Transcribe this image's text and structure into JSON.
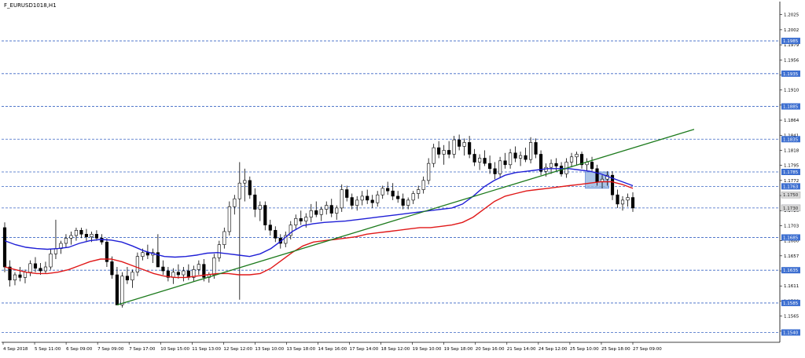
{
  "window": {
    "title": "F_EURUSD1018,H1"
  },
  "colors": {
    "background": "#ffffff",
    "bull_body": "#ffffff",
    "bear_body": "#000000",
    "candle_outline": "#000000",
    "ma_fast": "#1f1fd6",
    "ma_slow": "#e01818",
    "trendline": "#1c7a1c",
    "level_line": "#3a66c4",
    "level_tag": "#3d6fd0",
    "zone_fill": "#8fb0dd",
    "axis": "#000000",
    "grid": "#6b8fd4"
  },
  "chart_data": {
    "type": "candlestick",
    "title": "F_EURUSD1018,H1",
    "ylim": [
      1.1525,
      1.2045
    ],
    "grid": "horizontal dashed price levels",
    "y_ticks": [
      "1.2025",
      "1.2002",
      "1.1979",
      "1.1956",
      "1.1933",
      "1.1910",
      "1.1887",
      "1.1864",
      "1.1841",
      "1.1818",
      "1.1795",
      "1.1772",
      "1.1749",
      "1.1726",
      "1.1703",
      "1.1680",
      "1.1657",
      "1.1634",
      "1.1611",
      "1.1588",
      "1.1565",
      "1.1542"
    ],
    "level_lines": [
      "1.1985",
      "1.1935",
      "1.1885",
      "1.1835",
      "1.1785",
      "1.1763",
      "1.1730",
      "1.1685",
      "1.1635",
      "1.1585",
      "1.1540"
    ],
    "x_labels": [
      "4 Sep 2018",
      "5 Sep 11:00",
      "6 Sep 09:00",
      "7 Sep 09:00",
      "7 Sep 17:00",
      "10 Sep 15:00",
      "11 Sep 13:00",
      "12 Sep 12:00",
      "13 Sep 10:00",
      "13 Sep 18:00",
      "14 Sep 16:00",
      "17 Sep 14:00",
      "18 Sep 12:00",
      "19 Sep 10:00",
      "19 Sep 18:00",
      "20 Sep 16:00",
      "21 Sep 14:00",
      "24 Sep 12:00",
      "25 Sep 10:00",
      "25 Sep 18:00",
      "27 Sep 09:00"
    ],
    "candles": [
      [
        1.17,
        1.1708,
        1.1632,
        1.164
      ],
      [
        1.164,
        1.165,
        1.161,
        1.162
      ],
      [
        1.162,
        1.1632,
        1.1612,
        1.1628
      ],
      [
        1.1628,
        1.164,
        1.1618,
        1.1624
      ],
      [
        1.1624,
        1.1636,
        1.1615,
        1.1632
      ],
      [
        1.1632,
        1.165,
        1.1626,
        1.1645
      ],
      [
        1.1645,
        1.1655,
        1.1632,
        1.1638
      ],
      [
        1.1638,
        1.1646,
        1.1628,
        1.1634
      ],
      [
        1.1634,
        1.1648,
        1.163,
        1.164
      ],
      [
        1.164,
        1.1668,
        1.1636,
        1.166
      ],
      [
        1.166,
        1.1712,
        1.1652,
        1.1668
      ],
      [
        1.1668,
        1.168,
        1.166,
        1.1676
      ],
      [
        1.1676,
        1.169,
        1.167,
        1.1684
      ],
      [
        1.1684,
        1.1694,
        1.1674,
        1.1688
      ],
      [
        1.1688,
        1.17,
        1.168,
        1.1696
      ],
      [
        1.1696,
        1.17,
        1.1684,
        1.169
      ],
      [
        1.169,
        1.1698,
        1.1678,
        1.1686
      ],
      [
        1.1686,
        1.1694,
        1.1678,
        1.169
      ],
      [
        1.169,
        1.1696,
        1.168,
        1.1684
      ],
      [
        1.1684,
        1.169,
        1.1674,
        1.1678
      ],
      [
        1.1678,
        1.1684,
        1.164,
        1.1648
      ],
      [
        1.1648,
        1.1656,
        1.1622,
        1.1628
      ],
      [
        1.1628,
        1.164,
        1.1592,
        1.1582
      ],
      [
        1.1582,
        1.1632,
        1.1578,
        1.1626
      ],
      [
        1.1626,
        1.164,
        1.1614,
        1.162
      ],
      [
        1.162,
        1.1636,
        1.1608,
        1.1632
      ],
      [
        1.1632,
        1.1662,
        1.1626,
        1.1656
      ],
      [
        1.1656,
        1.1668,
        1.165,
        1.1662
      ],
      [
        1.1662,
        1.1674,
        1.1652,
        1.1658
      ],
      [
        1.1658,
        1.1668,
        1.1646,
        1.1662
      ],
      [
        1.1662,
        1.169,
        1.1656,
        1.164
      ],
      [
        1.164,
        1.165,
        1.1628,
        1.1634
      ],
      [
        1.1634,
        1.164,
        1.1618,
        1.1624
      ],
      [
        1.1624,
        1.1638,
        1.1614,
        1.1632
      ],
      [
        1.1632,
        1.1644,
        1.1622,
        1.1628
      ],
      [
        1.1628,
        1.164,
        1.1618,
        1.1634
      ],
      [
        1.1634,
        1.1644,
        1.162,
        1.1624
      ],
      [
        1.1624,
        1.1642,
        1.1618,
        1.1636
      ],
      [
        1.1636,
        1.165,
        1.1628,
        1.1644
      ],
      [
        1.1644,
        1.1652,
        1.1618,
        1.1624
      ],
      [
        1.1624,
        1.1632,
        1.1616,
        1.1628
      ],
      [
        1.1628,
        1.166,
        1.1622,
        1.1654
      ],
      [
        1.1654,
        1.168,
        1.1648,
        1.1674
      ],
      [
        1.1674,
        1.17,
        1.1668,
        1.1694
      ],
      [
        1.1694,
        1.174,
        1.1688,
        1.1732
      ],
      [
        1.1732,
        1.175,
        1.172,
        1.1744
      ],
      [
        1.1744,
        1.18,
        1.159,
        1.1768
      ],
      [
        1.1768,
        1.179,
        1.174,
        1.1772
      ],
      [
        1.1772,
        1.1778,
        1.1744,
        1.175
      ],
      [
        1.175,
        1.176,
        1.1716,
        1.1728
      ],
      [
        1.1728,
        1.174,
        1.171,
        1.1734
      ],
      [
        1.1734,
        1.174,
        1.1696,
        1.1704
      ],
      [
        1.1704,
        1.1712,
        1.1688,
        1.1696
      ],
      [
        1.1696,
        1.1702,
        1.1678,
        1.1684
      ],
      [
        1.1684,
        1.169,
        1.1668,
        1.1676
      ],
      [
        1.1676,
        1.1694,
        1.167,
        1.1688
      ],
      [
        1.1688,
        1.171,
        1.1682,
        1.1704
      ],
      [
        1.1704,
        1.172,
        1.1698,
        1.1714
      ],
      [
        1.1714,
        1.1726,
        1.1704,
        1.171
      ],
      [
        1.171,
        1.1722,
        1.17,
        1.1716
      ],
      [
        1.1716,
        1.1736,
        1.1708,
        1.1726
      ],
      [
        1.1726,
        1.174,
        1.1716,
        1.172
      ],
      [
        1.172,
        1.1732,
        1.171,
        1.1728
      ],
      [
        1.1728,
        1.174,
        1.172,
        1.1734
      ],
      [
        1.1734,
        1.1744,
        1.1716,
        1.1722
      ],
      [
        1.1722,
        1.1734,
        1.1712,
        1.173
      ],
      [
        1.173,
        1.1766,
        1.1724,
        1.1758
      ],
      [
        1.1758,
        1.1764,
        1.174,
        1.1746
      ],
      [
        1.1746,
        1.1752,
        1.1728,
        1.1734
      ],
      [
        1.1734,
        1.1748,
        1.1726,
        1.1742
      ],
      [
        1.1742,
        1.1756,
        1.1734,
        1.1748
      ],
      [
        1.1748,
        1.1758,
        1.1736,
        1.1742
      ],
      [
        1.1742,
        1.175,
        1.173,
        1.1738
      ],
      [
        1.1738,
        1.1756,
        1.1732,
        1.175
      ],
      [
        1.175,
        1.1764,
        1.1744,
        1.176
      ],
      [
        1.176,
        1.177,
        1.175,
        1.1756
      ],
      [
        1.1756,
        1.1768,
        1.1742,
        1.1748
      ],
      [
        1.1748,
        1.1756,
        1.1738,
        1.1744
      ],
      [
        1.1744,
        1.1752,
        1.1728,
        1.1734
      ],
      [
        1.1734,
        1.1746,
        1.1728,
        1.1742
      ],
      [
        1.1742,
        1.1756,
        1.1736,
        1.1752
      ],
      [
        1.1752,
        1.1764,
        1.1744,
        1.1758
      ],
      [
        1.1758,
        1.1778,
        1.1752,
        1.1772
      ],
      [
        1.1772,
        1.1806,
        1.1766,
        1.1798
      ],
      [
        1.1798,
        1.1828,
        1.1792,
        1.1822
      ],
      [
        1.1822,
        1.1832,
        1.1806,
        1.1812
      ],
      [
        1.1812,
        1.1826,
        1.1796,
        1.1818
      ],
      [
        1.1818,
        1.1832,
        1.1806,
        1.1812
      ],
      [
        1.1812,
        1.184,
        1.1806,
        1.1834
      ],
      [
        1.1834,
        1.1842,
        1.1818,
        1.1824
      ],
      [
        1.1824,
        1.1836,
        1.181,
        1.183
      ],
      [
        1.183,
        1.184,
        1.1806,
        1.1812
      ],
      [
        1.1812,
        1.182,
        1.1794,
        1.18
      ],
      [
        1.18,
        1.1812,
        1.1788,
        1.1806
      ],
      [
        1.1806,
        1.1818,
        1.1794,
        1.1798
      ],
      [
        1.1798,
        1.181,
        1.1782,
        1.179
      ],
      [
        1.179,
        1.18,
        1.1774,
        1.1782
      ],
      [
        1.1782,
        1.1808,
        1.1776,
        1.1802
      ],
      [
        1.1802,
        1.1814,
        1.179,
        1.1796
      ],
      [
        1.1796,
        1.182,
        1.179,
        1.1814
      ],
      [
        1.1814,
        1.1824,
        1.18,
        1.1806
      ],
      [
        1.1806,
        1.1816,
        1.1794,
        1.181
      ],
      [
        1.181,
        1.1822,
        1.18,
        1.1804
      ],
      [
        1.1804,
        1.1838,
        1.1798,
        1.183
      ],
      [
        1.183,
        1.1836,
        1.1806,
        1.1812
      ],
      [
        1.1812,
        1.1818,
        1.178,
        1.1786
      ],
      [
        1.1786,
        1.1798,
        1.1778,
        1.1792
      ],
      [
        1.1792,
        1.1804,
        1.1782,
        1.1798
      ],
      [
        1.1798,
        1.1806,
        1.1786,
        1.1794
      ],
      [
        1.1794,
        1.18,
        1.1778,
        1.1782
      ],
      [
        1.1782,
        1.1806,
        1.1776,
        1.18
      ],
      [
        1.18,
        1.1814,
        1.1792,
        1.1808
      ],
      [
        1.1808,
        1.1816,
        1.1796,
        1.1812
      ],
      [
        1.1812,
        1.1816,
        1.179,
        1.1796
      ],
      [
        1.1796,
        1.1806,
        1.1786,
        1.18
      ],
      [
        1.18,
        1.1808,
        1.1786,
        1.179
      ],
      [
        1.179,
        1.1796,
        1.1764,
        1.177
      ],
      [
        1.177,
        1.178,
        1.176,
        1.1774
      ],
      [
        1.1774,
        1.1786,
        1.1764,
        1.178
      ],
      [
        1.178,
        1.1786,
        1.1742,
        1.175
      ],
      [
        1.175,
        1.1758,
        1.173,
        1.1736
      ],
      [
        1.1736,
        1.1748,
        1.1726,
        1.1742
      ],
      [
        1.1742,
        1.1752,
        1.1732,
        1.1746
      ],
      [
        1.1746,
        1.1754,
        1.1724,
        1.173
      ]
    ],
    "ma_fast": [
      1.168,
      1.1674,
      1.167,
      1.1668,
      1.1667,
      1.1668,
      1.167,
      1.1676,
      1.168,
      1.1682,
      1.1681,
      1.1678,
      1.1672,
      1.1665,
      1.166,
      1.1656,
      1.1655,
      1.1656,
      1.1658,
      1.1661,
      1.1662,
      1.166,
      1.1658,
      1.1656,
      1.166,
      1.1668,
      1.168,
      1.1694,
      1.1703,
      1.1706,
      1.1708,
      1.1709,
      1.171,
      1.1712,
      1.1714,
      1.1716,
      1.1718,
      1.172,
      1.1722,
      1.1724,
      1.1726,
      1.1728,
      1.173,
      1.1736,
      1.1748,
      1.1762,
      1.1772,
      1.178,
      1.1784,
      1.1786,
      1.1788,
      1.179,
      1.179,
      1.179,
      1.1788,
      1.1786,
      1.1782,
      1.1776,
      1.177,
      1.1764
    ],
    "ma_slow": [
      1.164,
      1.1636,
      1.1632,
      1.163,
      1.163,
      1.1632,
      1.1636,
      1.1642,
      1.1648,
      1.1652,
      1.1652,
      1.1648,
      1.1642,
      1.1636,
      1.163,
      1.1626,
      1.1624,
      1.1624,
      1.1626,
      1.1628,
      1.163,
      1.163,
      1.1628,
      1.1628,
      1.163,
      1.1638,
      1.165,
      1.1662,
      1.1672,
      1.1678,
      1.168,
      1.1682,
      1.1684,
      1.1686,
      1.169,
      1.1692,
      1.1694,
      1.1696,
      1.1698,
      1.17,
      1.17,
      1.1702,
      1.1704,
      1.1708,
      1.1716,
      1.1728,
      1.174,
      1.1748,
      1.1752,
      1.1756,
      1.1758,
      1.176,
      1.1762,
      1.1764,
      1.1766,
      1.1768,
      1.177,
      1.177,
      1.1766,
      1.176
    ],
    "trendline": {
      "from": [
        22,
        1.1582
      ],
      "to": [
        135,
        1.185
      ]
    },
    "zone": {
      "start": 114,
      "end": 118,
      "high": 1.1785,
      "low": 1.176
    },
    "price_tags_grey": [
      "1.1750",
      "1.1730"
    ]
  }
}
